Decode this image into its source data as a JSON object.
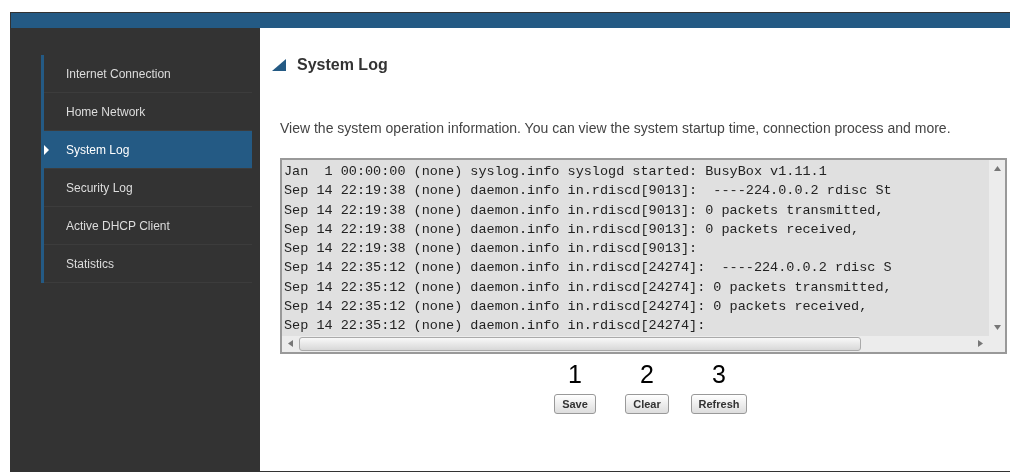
{
  "sidebar": {
    "items": [
      {
        "label": "Internet Connection",
        "selected": false
      },
      {
        "label": "Home Network",
        "selected": false
      },
      {
        "label": "System Log",
        "selected": true
      },
      {
        "label": "Security Log",
        "selected": false
      },
      {
        "label": "Active DHCP Client",
        "selected": false
      },
      {
        "label": "Statistics",
        "selected": false
      }
    ]
  },
  "page": {
    "title": "System Log",
    "description": "View the system operation information. You can view the system startup time, connection process and more.",
    "log_lines": [
      "Jan  1 00:00:00 (none) syslog.info syslogd started: BusyBox v1.11.1",
      "Sep 14 22:19:38 (none) daemon.info in.rdiscd[9013]:  ----224.0.0.2 rdisc St",
      "Sep 14 22:19:38 (none) daemon.info in.rdiscd[9013]: 0 packets transmitted,",
      "Sep 14 22:19:38 (none) daemon.info in.rdiscd[9013]: 0 packets received,",
      "Sep 14 22:19:38 (none) daemon.info in.rdiscd[9013]:",
      "Sep 14 22:35:12 (none) daemon.info in.rdiscd[24274]:  ----224.0.0.2 rdisc S",
      "Sep 14 22:35:12 (none) daemon.info in.rdiscd[24274]: 0 packets transmitted,",
      "Sep 14 22:35:12 (none) daemon.info in.rdiscd[24274]: 0 packets received,",
      "Sep 14 22:35:12 (none) daemon.info in.rdiscd[24274]:"
    ],
    "buttons": [
      {
        "number": "1",
        "label": "Save"
      },
      {
        "number": "2",
        "label": "Clear"
      },
      {
        "number": "3",
        "label": "Refresh"
      }
    ]
  }
}
